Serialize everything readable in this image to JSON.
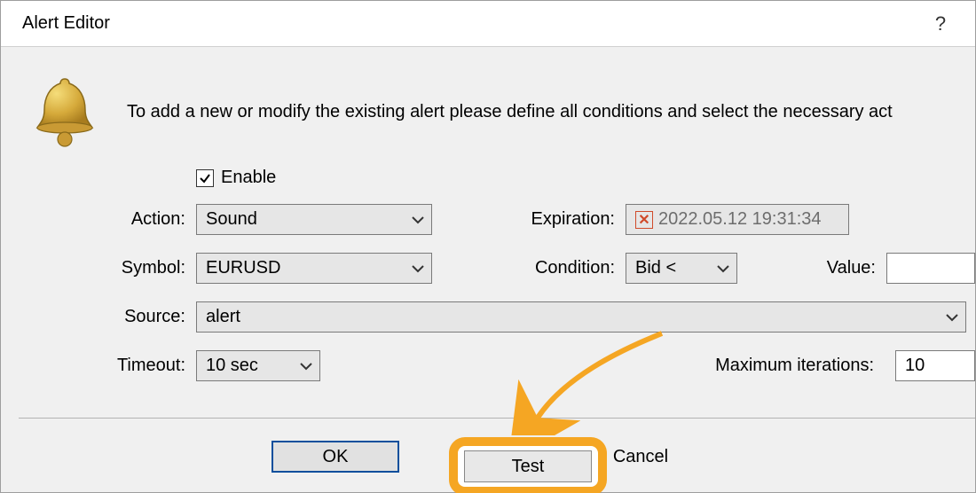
{
  "window": {
    "title": "Alert Editor"
  },
  "instruction": "To add a new or modify the existing alert please define all conditions and select the necessary act",
  "enable": {
    "label": "Enable",
    "checked": true
  },
  "fields": {
    "action": {
      "label": "Action:",
      "value": "Sound"
    },
    "symbol": {
      "label": "Symbol:",
      "value": "EURUSD"
    },
    "source": {
      "label": "Source:",
      "value": "alert"
    },
    "timeout": {
      "label": "Timeout:",
      "value": "10 sec"
    },
    "expiration": {
      "label": "Expiration:",
      "value": "2022.05.12 19:31:34"
    },
    "condition": {
      "label": "Condition:",
      "value": "Bid <"
    },
    "value": {
      "label": "Value:",
      "value": ""
    },
    "max_iter": {
      "label": "Maximum iterations:",
      "value": "10"
    }
  },
  "buttons": {
    "ok": "OK",
    "test": "Test",
    "cancel": "Cancel"
  }
}
